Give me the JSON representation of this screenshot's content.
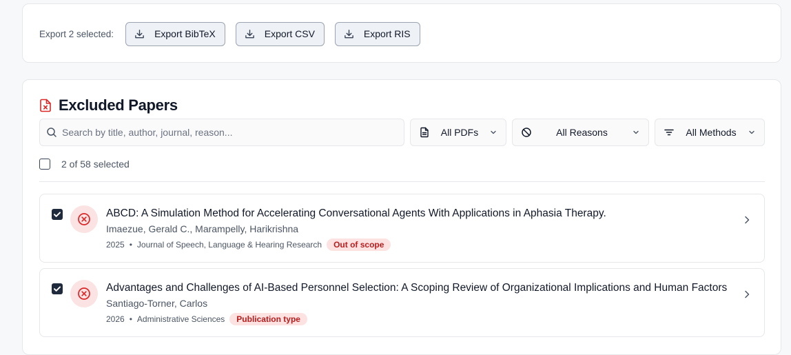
{
  "export": {
    "label": "Export 2 selected:",
    "buttons": [
      {
        "label": "Export BibTeX",
        "icon": "download-icon"
      },
      {
        "label": "Export CSV",
        "icon": "download-icon"
      },
      {
        "label": "Export RIS",
        "icon": "download-icon"
      }
    ]
  },
  "papers_section": {
    "title": "Excluded Papers",
    "title_icon": "file-x-icon",
    "search_placeholder": "Search by title, author, journal, reason...",
    "filters": {
      "pdfs": "All PDFs",
      "reasons": "All Reasons",
      "methods": "All Methods"
    },
    "selection_count": "2 of 58 selected",
    "papers": [
      {
        "title": "ABCD: A Simulation Method for Accelerating Conversational Agents With Applications in Aphasia Therapy.",
        "authors": "Imaezue, Gerald C., Marampelly, Harikrishna",
        "year": "2025",
        "journal": "Journal of Speech, Language & Hearing Research",
        "reason": "Out of scope",
        "selected": true
      },
      {
        "title": "Advantages and Challenges of AI-Based Personnel Selection: A Scoping Review of Organizational Implications and Human Factors",
        "authors": "Santiago-Torner, Carlos",
        "year": "2026",
        "journal": "Administrative Sciences",
        "reason": "Publication type",
        "selected": true
      }
    ]
  },
  "colors": {
    "background": "#f6f8fa",
    "accent_dark": "#1f2a3d",
    "excluded_red": "#dc2626",
    "badge_bg": "#fde2e2",
    "badge_text": "#b91c1c"
  }
}
